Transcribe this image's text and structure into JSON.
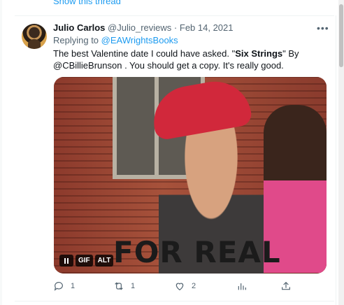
{
  "thread": {
    "show_thread_label": "Show this thread"
  },
  "tweet": {
    "author_name": "Julio Carlos",
    "author_handle": "@Julio_reviews",
    "separator": "·",
    "date": "Feb 14, 2021",
    "more_label": "•••",
    "replying_prefix": "Replying to ",
    "replying_to": "@EAWrightsBooks",
    "text_part1": "The best Valentine date I could have asked. \"",
    "text_bold": "Six Strings",
    "text_part2": "\" By @CBillieBrunson . You should get a copy. It's really good.",
    "media": {
      "caption": "FOR REAL",
      "gif_label": "GIF",
      "alt_label": "ALT"
    },
    "actions": {
      "reply_count": "1",
      "retweet_count": "1",
      "like_count": "2"
    }
  },
  "icons": [
    "more-icon",
    "pause-icon",
    "reply-icon",
    "retweet-icon",
    "like-icon",
    "analytics-icon",
    "share-icon"
  ],
  "colors": {
    "link": "#1d9bf0",
    "secondary_text": "#536471",
    "primary_text": "#0f1419"
  }
}
